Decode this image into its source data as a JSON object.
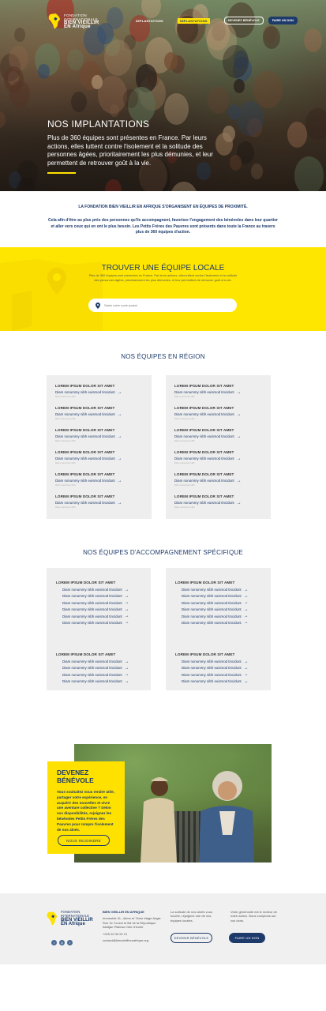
{
  "header": {
    "logo": {
      "line1": "FONDATION",
      "line2": "INTERNATIONALE",
      "line3": "BIEN VIEILLIR",
      "line4": "EN Afrique"
    },
    "nav": [
      {
        "label": "IMPLANTATIONS"
      },
      {
        "label": "IMPLANTATIONS"
      }
    ],
    "btn_volunteer": "DEVENEZ BÉNÉVOLE",
    "btn_donate": "FAIRE UN DON"
  },
  "hero": {
    "title": "NOS IMPLANTATIONS",
    "text": "Plus de 360 équipes sont présentes en France. Par leurs actions,  elles luttent contre l'isolement et la solitude des personnes âgées, prioritairement les plus démunies, et leur permettent de retrouver goût à la vie."
  },
  "intro": {
    "title": "LA FONDATION BIEN VIEILLIR EN AFRIQUE  S'ORGANISENT EN ÉQUIPES DE PROXIMITÉ.",
    "text": "Cela afin d'être au plus près des personnes qu'ils accompagnent, favoriser l'engagement des bénévoles dans leur quartier et aller vers ceux qui en ont le plus besoin. Les Petits Frères des Pauvres sont présents dans toute la France au travers plus de 360 équipes d'action."
  },
  "finder": {
    "title": "TROUVER UNE ÉQUIPE LOCALE",
    "text": "Plus de 360 équipes sont présentes en France. Par leurs actions, elles luttent contre l'isolement et la solitude des personnes âgées, prioritairement les plus démunies, et leur permettent de retrouver goût à la vie.",
    "search_placeholder": "Saisir votre code postal"
  },
  "regions": {
    "title": "NOS ÉQUIPES EN RÉGION",
    "group_title": "LOREM IPSUM DOLOR SIT AMET",
    "link_label": "Diam nonummy nibh euismod tincidunt",
    "sub_label": "Diam nonummy nibh",
    "arrow": "→"
  },
  "specific": {
    "title": "NOS ÉQUIPES D'ACCOMPAGNEMENT SPÉCIFIQUE",
    "group_title": "LOREM IPSUM DOLOR SIT AMET",
    "link_label": "Diam nonummy nibh euismod tincidunt",
    "arrow": "→"
  },
  "volunteer": {
    "title": "DEVENEZ BÉNÉVOLE",
    "text": "Vous souhaitez vous rendre utile, partager votre expérience, en acquérir des nouvelles et vivre une aventure collective ? Selon vos disponibilités, rejoignez les bénévoles Petits Frères des Pauvres pour rompre l'isolement de nos aînés.",
    "button": "NOUS REJOINDRE"
  },
  "footer": {
    "org_name": "BIEN VIEILLIR EN AFRIQUE",
    "address": "Immeuble XL, 4ème et 7ème étage Angle Rue Gr Crozet et Bd de la République Abidjan Plateau Côte d'Ivoire",
    "phone": "+225 20 30 92 21",
    "email": "contact@bienvieillirenafrique.org",
    "col2_text": "La solitude de nos aînés vous touche, rejoignez une de nos équipes locales.",
    "col3_text": "Votre générosité est le moteur de notre action. Nous comptons sur vos dons.",
    "btn_volunteer": "DEVENIR BÉNÉVOLE",
    "btn_donate": "FAIRE UN DON",
    "socials": [
      "twitter-icon",
      "instagram-icon",
      "facebook-icon"
    ]
  },
  "colors": {
    "navy": "#1d3a6b",
    "yellow": "#ffe600",
    "grey": "#eeeeee"
  }
}
